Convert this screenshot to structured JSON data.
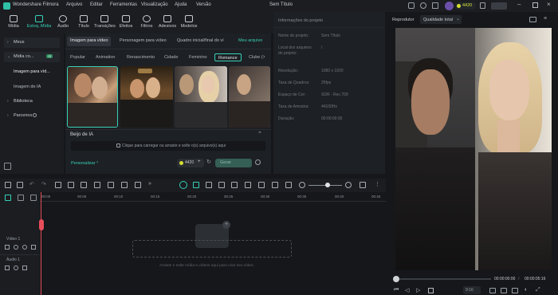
{
  "app": {
    "title": "Wondershare Filmora",
    "project": "Sem Título"
  },
  "menu": [
    "Arquivo",
    "Editar",
    "Ferramentas",
    "Visualização",
    "Ajuda",
    "Versão"
  ],
  "credits": "4420",
  "toolbar": [
    "Mídia",
    "Estoq..Mídia",
    "Áudio",
    "Título",
    "Transições",
    "Efeitos",
    "Filtros",
    "Adesivos",
    "Modelos"
  ],
  "sidebar": {
    "mine": "Meus",
    "stock": "Mídia co...",
    "stock_badge": "AI",
    "sub": [
      "Imagem para víd...",
      "Imagem de IA"
    ],
    "library": "Biblioteca",
    "partners": "Parceiros"
  },
  "content": {
    "tabs": [
      "Imagem para vídeo",
      "Personagem para vídeo",
      "Quadro inicial/final do ví",
      "Meu arquivo"
    ],
    "chips": [
      "Popular",
      "Animation",
      "Renascimento",
      "Cidade",
      "Feminino",
      "Romance",
      "Clube ("
    ],
    "section": "Beijo de IA",
    "upload": "Clique para carregar ou arraste e solte o(s) arquivo(s) aqui",
    "customize": "Personalizar",
    "credit_btn": "4420",
    "generate_btn": "Gerar"
  },
  "project_info": {
    "title": "Informações do projeto",
    "rows": [
      {
        "label": "Nome do projeto:",
        "value": "Sem Título"
      },
      {
        "label": "Local dos arquivos do projeto:",
        "value": "/"
      },
      {
        "label": "Resolução:",
        "value": "1080 x 1920"
      },
      {
        "label": "Taxa de Quadros:",
        "value": "25fps"
      },
      {
        "label": "Espaço de Cor:",
        "value": "SDR - Rec.709"
      },
      {
        "label": "Taxa de Amostra:",
        "value": "44100Hz"
      },
      {
        "label": "Duração:",
        "value": "00:00:00:00"
      }
    ]
  },
  "player": {
    "label": "Reprodutor",
    "quality": "Qualidade total",
    "time_current": "00:00:00:00",
    "time_total": "00:00:05:16",
    "speed": "9:16"
  },
  "timeline": {
    "ticks": [
      "00:00",
      "00:05",
      "00:10",
      "00:15",
      "00:20",
      "00:25",
      "00:30",
      "00:35",
      "00:40",
      "00:45"
    ],
    "video_track": "Vídeo 1",
    "audio_track": "Áudio 1",
    "drop_hint": "Arraste e solte mídia e vídeos aqui para criar seu vídeo."
  },
  "colors": {
    "accent": "#37d1b6",
    "bg": "#15171a",
    "panel": "#1d2024"
  }
}
